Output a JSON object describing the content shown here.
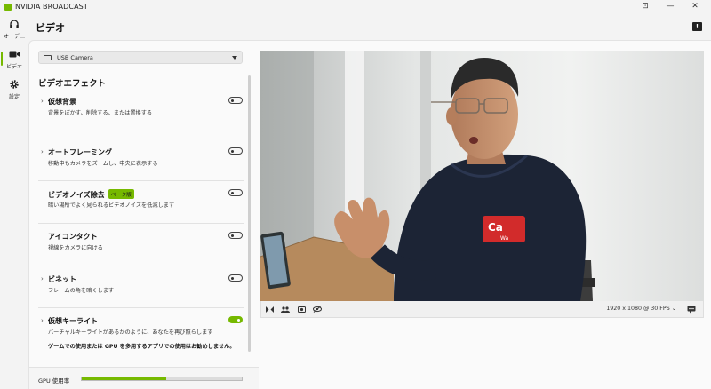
{
  "window": {
    "title": "NVIDIA BROADCAST",
    "controls": [
      "⊡",
      "—",
      "✕"
    ]
  },
  "sidebar": {
    "items": [
      {
        "label": "オーデ…",
        "icon": "headphones-icon"
      },
      {
        "label": "ビデオ",
        "icon": "video-camera-icon",
        "active": true
      },
      {
        "label": "設定",
        "icon": "gear-icon"
      }
    ]
  },
  "header": {
    "title": "ビデオ",
    "feedback_icon": "!"
  },
  "camera_select": {
    "value": "USB Camera"
  },
  "effects": {
    "title": "ビデオエフェクト",
    "items": [
      {
        "name": "仮想背景",
        "description": "背景をぼかす、削除する、または置換する",
        "expandable": true,
        "enabled": false
      },
      {
        "name": "オートフレーミング",
        "description": "移動中もカメラをズームし、中央に表示する",
        "expandable": true,
        "enabled": false
      },
      {
        "name": "ビデオノイズ除去",
        "badge": "ベータ版",
        "description": "暗い場所でよく見られるビデオノイズを低減します",
        "expandable": false,
        "enabled": false
      },
      {
        "name": "アイコンタクト",
        "description": "視線をカメラに向ける",
        "expandable": false,
        "enabled": false
      },
      {
        "name": "ビネット",
        "description": "フレームの角を暗くします",
        "expandable": true,
        "enabled": false
      },
      {
        "name": "仮想キーライト",
        "description": "バーチャルキーライトがあるかのように、あなたを再び照らします",
        "expandable": true,
        "enabled": true
      }
    ],
    "warning": "ゲームでの使用または GPU を多用するアプリでの使用はお勧めしません。"
  },
  "gpu": {
    "label": "GPU 使用率",
    "usage_fraction": 0.53
  },
  "preview": {
    "resolution": "1920 x 1080 @ 30 FPS",
    "shirt_text": "Ca",
    "shirt_subtext": "Wa"
  },
  "colors": {
    "accent": "#76b900",
    "background": "#f3f3f3",
    "panel": "#fafafa"
  }
}
